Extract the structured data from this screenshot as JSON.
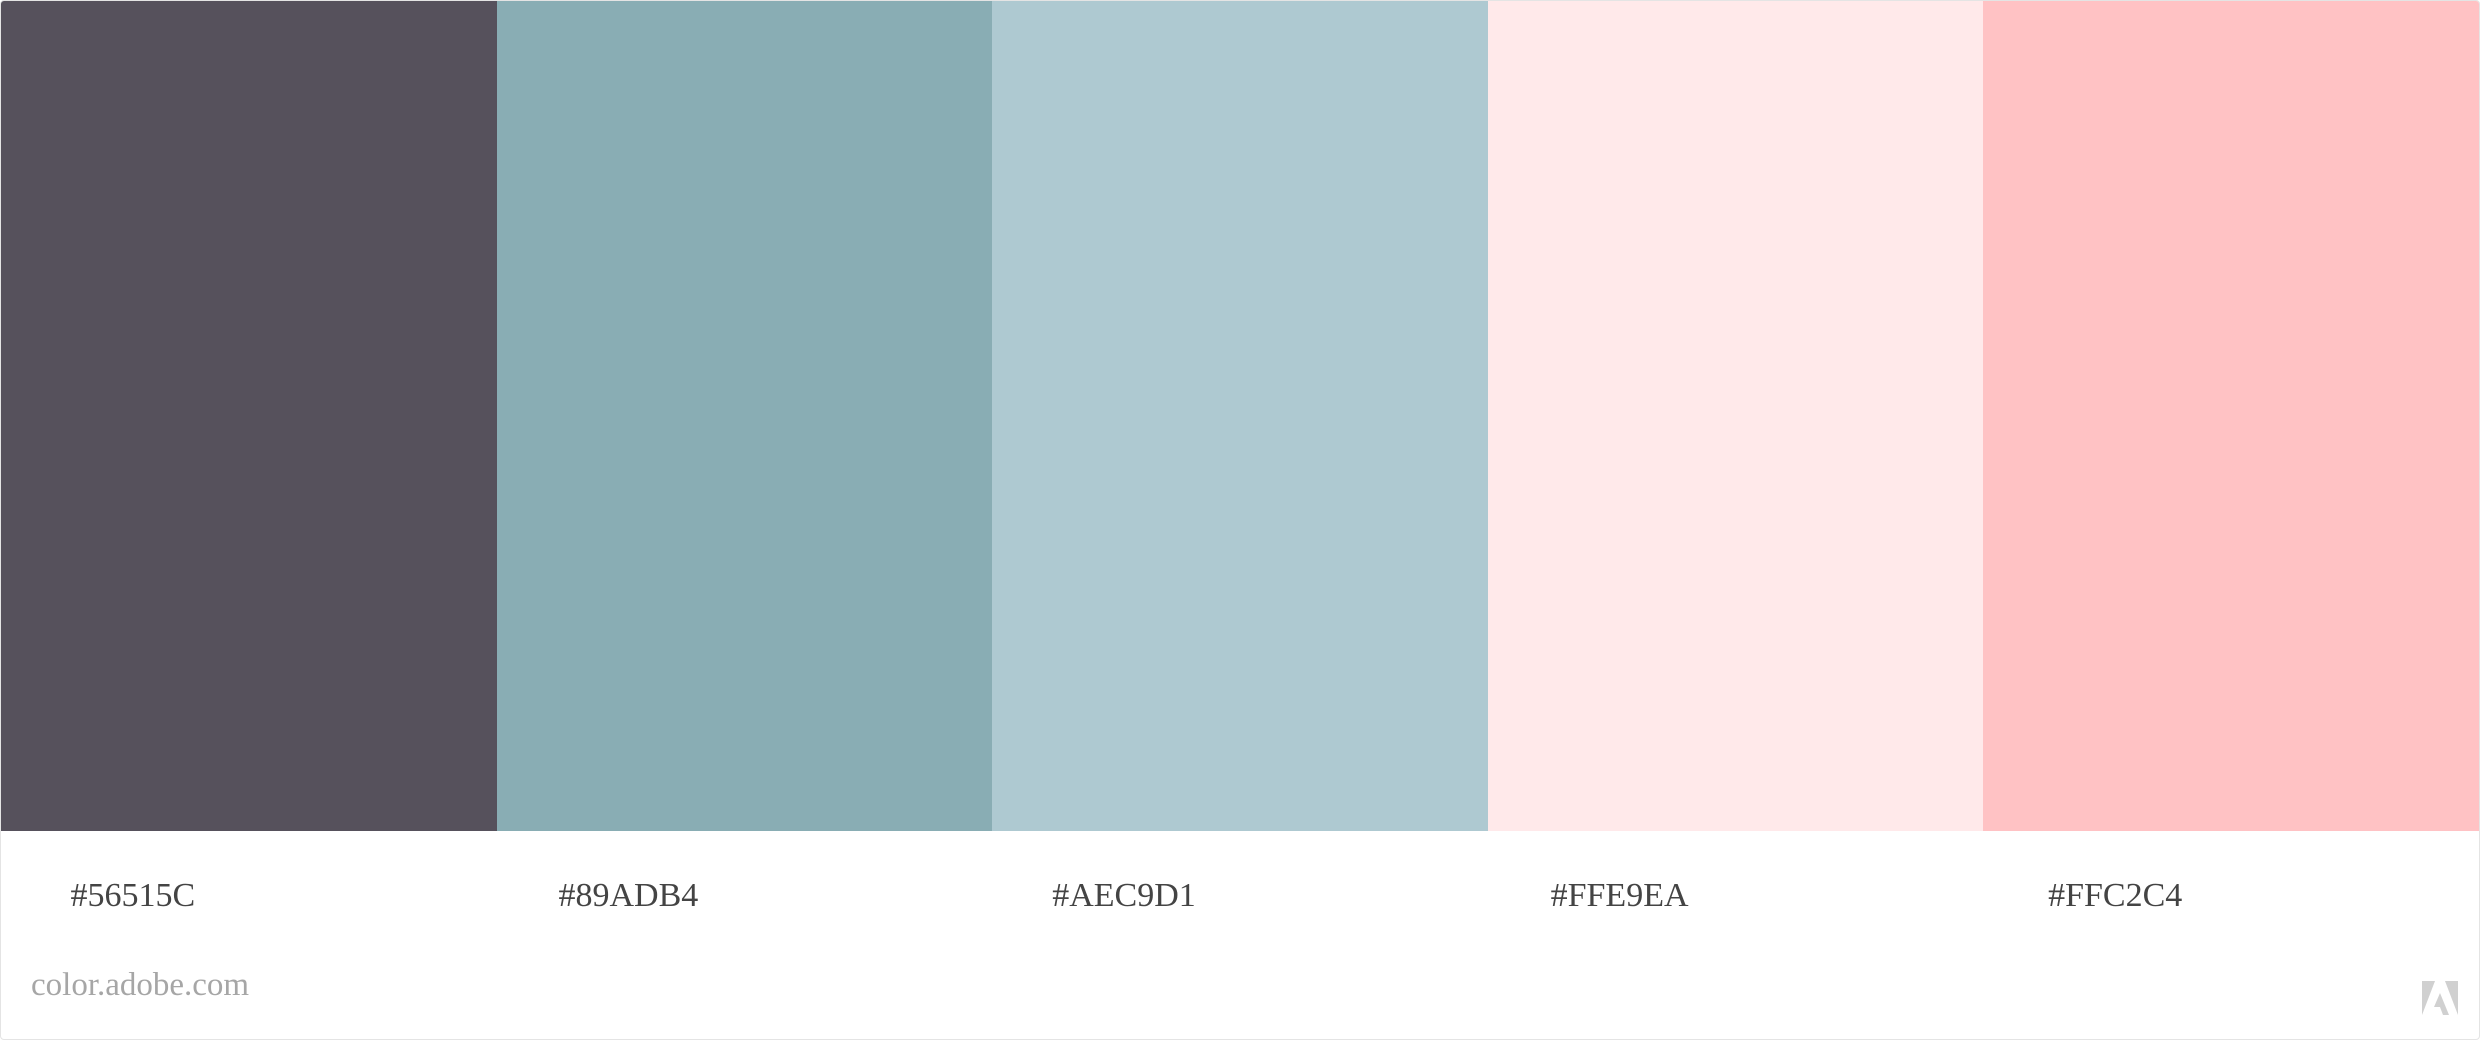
{
  "palette": {
    "swatches": [
      {
        "hex": "#56515C",
        "color": "#56515C"
      },
      {
        "hex": "#89ADB4",
        "color": "#89ADB4"
      },
      {
        "hex": "#AEC9D1",
        "color": "#AEC9D1"
      },
      {
        "hex": "#FFE9EA",
        "color": "#FFE9EA"
      },
      {
        "hex": "#FFC2C4",
        "color": "#FFC2C4"
      }
    ]
  },
  "footer": {
    "source_text": "color.adobe.com",
    "logo_icon": "adobe-logo-icon",
    "logo_color": "#d0d0d0"
  }
}
